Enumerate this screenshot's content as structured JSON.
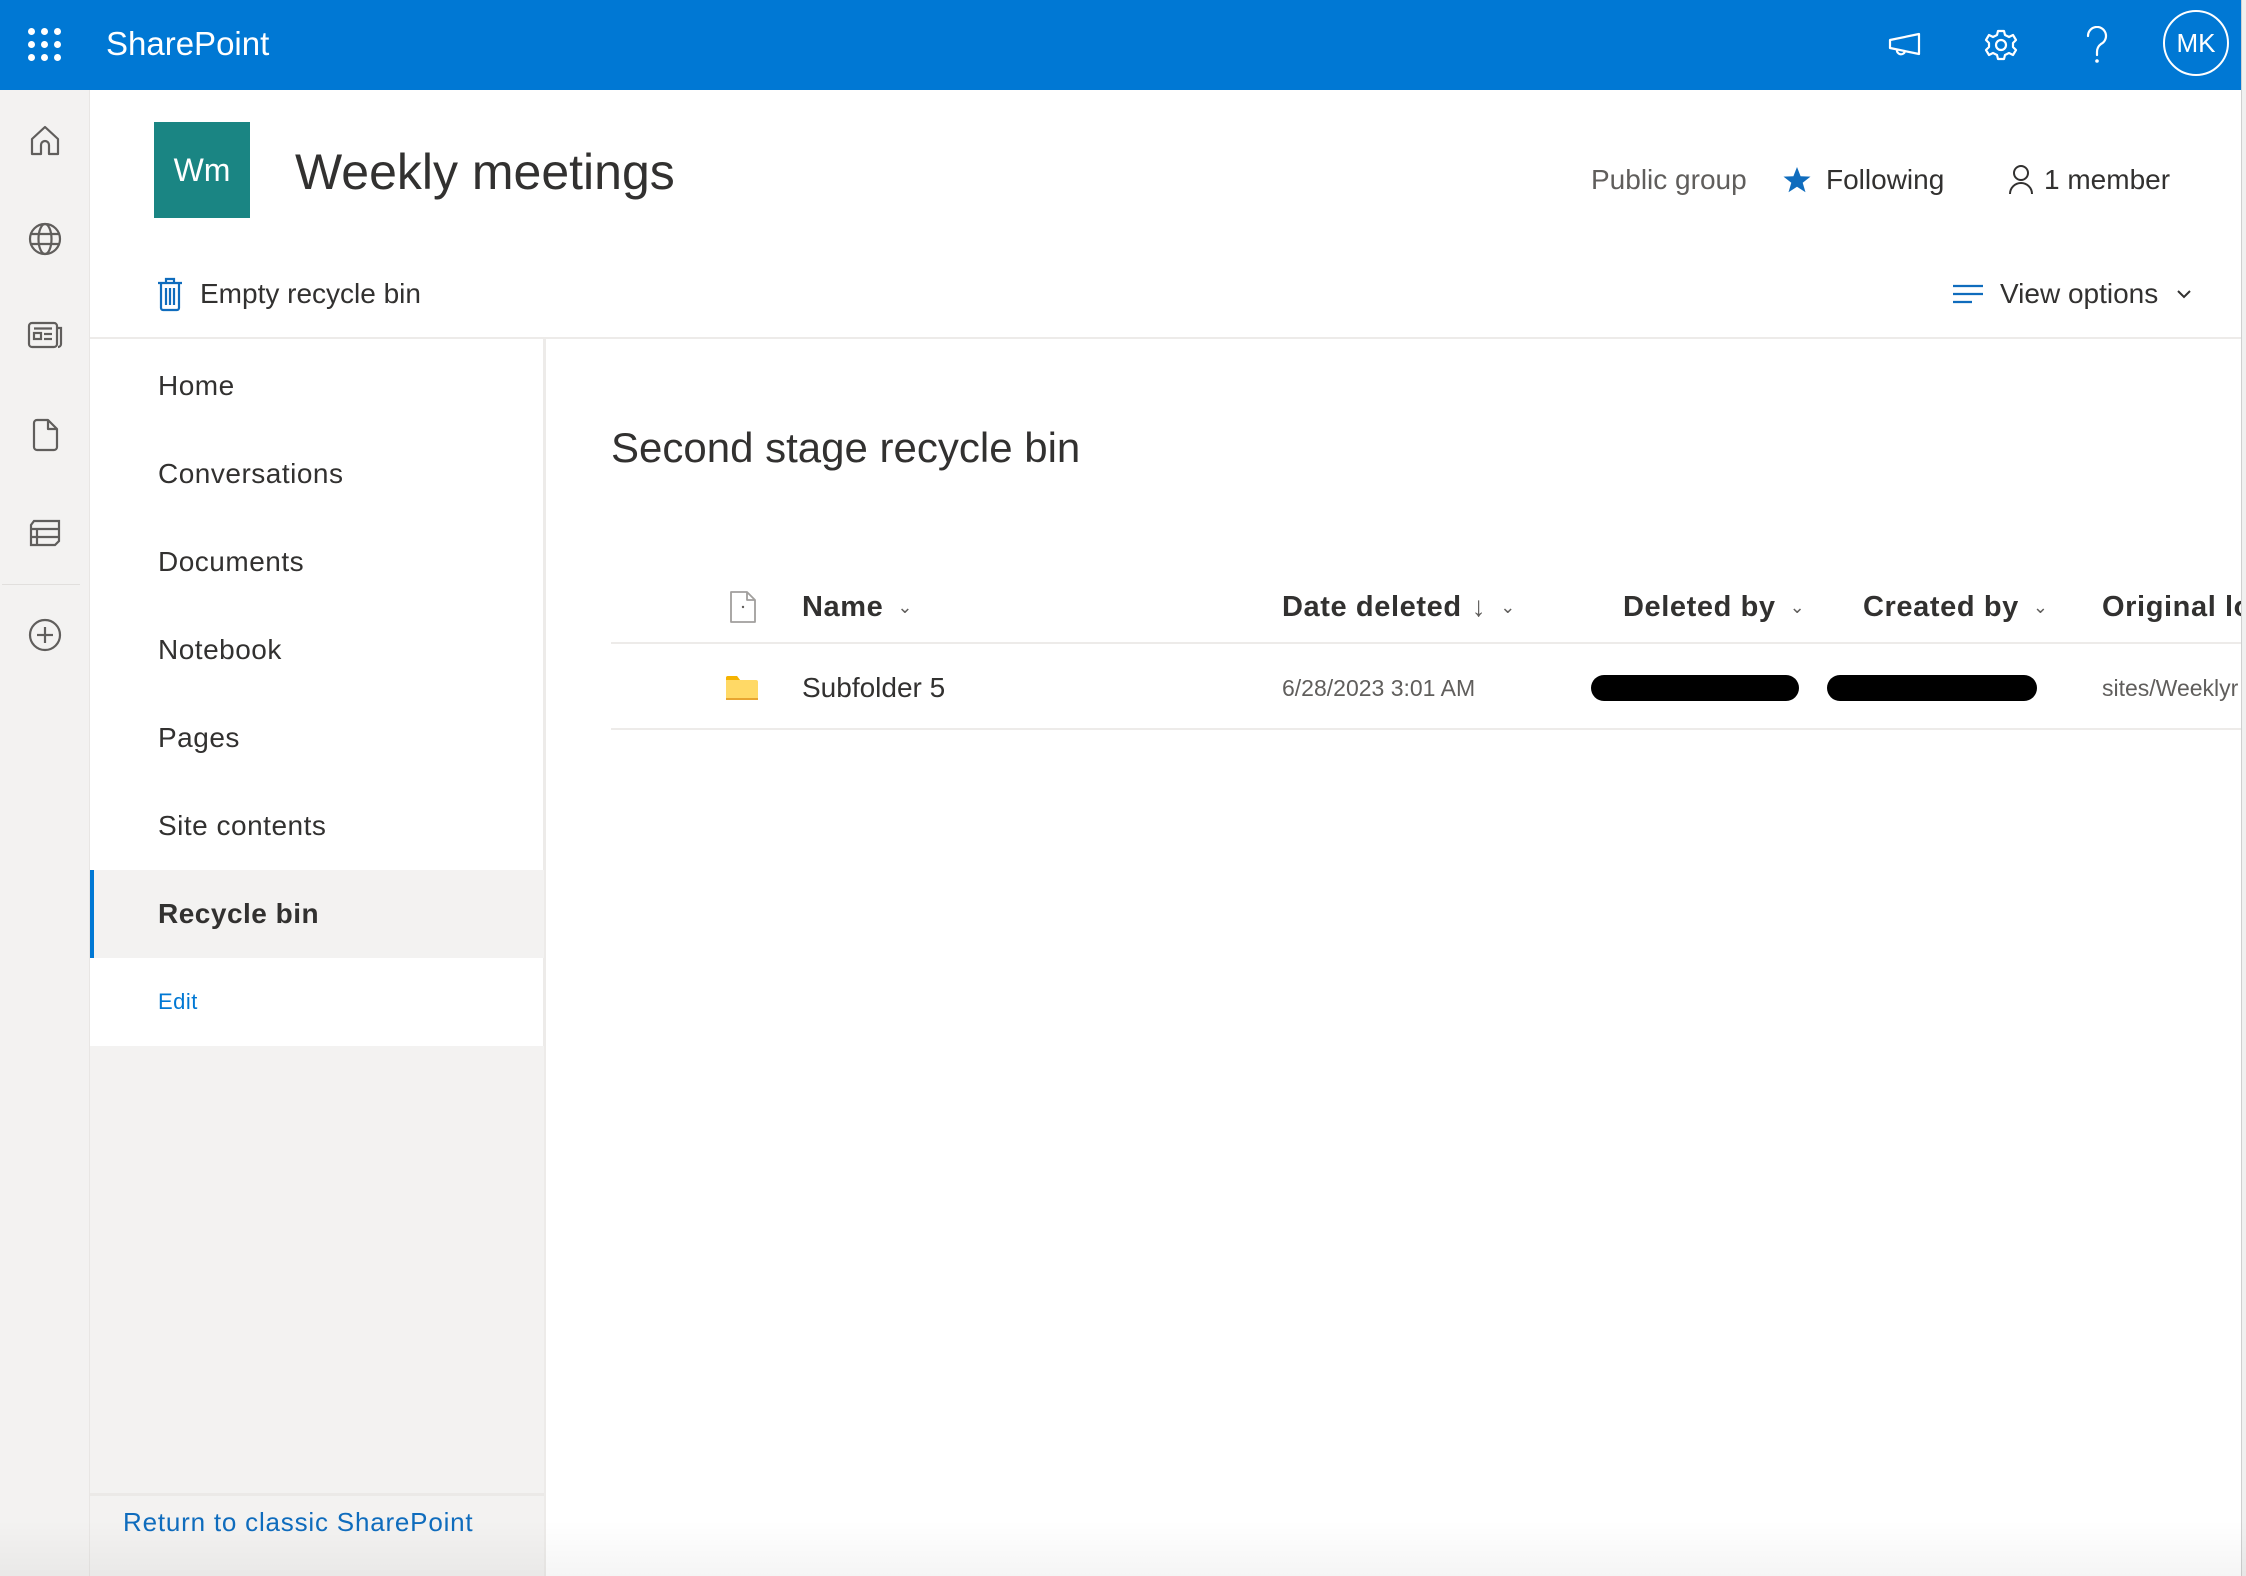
{
  "suite_bar": {
    "app_name": "SharePoint",
    "avatar_initials": "MK",
    "accent_color": "#0078d4",
    "icons": [
      "app-launcher-icon",
      "megaphone-icon",
      "settings-gear-icon",
      "help-icon"
    ]
  },
  "app_rail": {
    "items": [
      {
        "icon": "home-icon",
        "label": "Home"
      },
      {
        "icon": "globe-icon",
        "label": "Sites"
      },
      {
        "icon": "news-icon",
        "label": "News"
      },
      {
        "icon": "document-icon",
        "label": "Files"
      },
      {
        "icon": "list-icon",
        "label": "Lists"
      },
      {
        "icon": "add-circle-icon",
        "label": "Create"
      }
    ]
  },
  "site": {
    "logo_initials": "Wm",
    "logo_color": "#1a8583",
    "title": "Weekly meetings",
    "privacy": "Public group",
    "follow_label": "Following",
    "members_label": "1 member"
  },
  "command_bar": {
    "empty_recycle_bin": "Empty recycle bin",
    "view_options": "View options"
  },
  "nav": {
    "items": [
      {
        "label": "Home",
        "selected": false
      },
      {
        "label": "Conversations",
        "selected": false
      },
      {
        "label": "Documents",
        "selected": false
      },
      {
        "label": "Notebook",
        "selected": false
      },
      {
        "label": "Pages",
        "selected": false
      },
      {
        "label": "Site contents",
        "selected": false
      },
      {
        "label": "Recycle bin",
        "selected": true
      }
    ],
    "edit_label": "Edit",
    "return_classic": "Return to classic SharePoint"
  },
  "main": {
    "heading": "Second stage recycle bin",
    "columns": {
      "name": "Name",
      "date_deleted": "Date deleted",
      "date_deleted_sort": "↓",
      "deleted_by": "Deleted by",
      "created_by": "Created by",
      "original_location": "Original lo"
    },
    "rows": [
      {
        "type": "folder",
        "name": "Subfolder 5",
        "date_deleted": "6/28/2023 3:01 AM",
        "deleted_by": "[redacted]",
        "created_by": "[redacted]",
        "original_location": "sites/Weeklyr"
      }
    ]
  }
}
